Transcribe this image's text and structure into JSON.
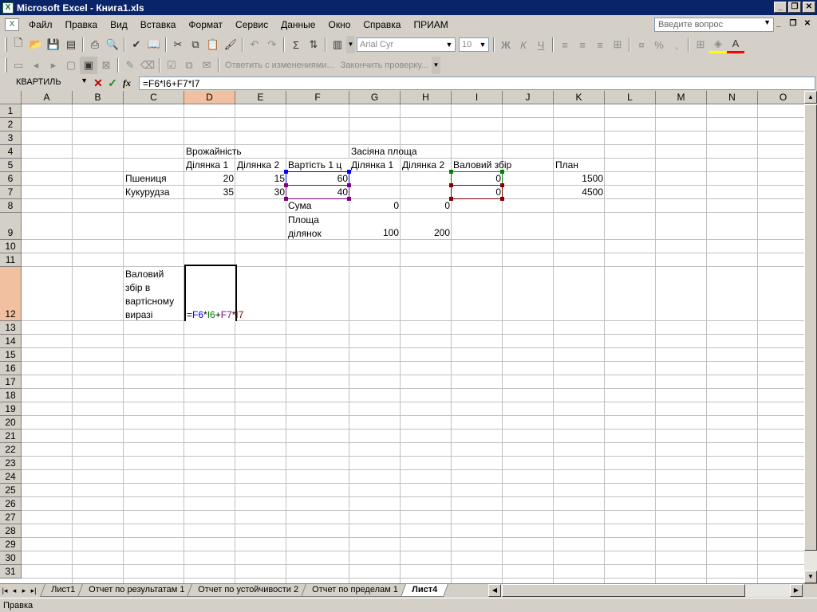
{
  "window": {
    "title": "Microsoft Excel - Книга1.xls"
  },
  "menu": [
    "Файл",
    "Правка",
    "Вид",
    "Вставка",
    "Формат",
    "Сервис",
    "Данные",
    "Окно",
    "Справка",
    "ПРИАМ"
  ],
  "ask": {
    "placeholder": "Введите вопрос"
  },
  "toolbar": {
    "font": "Arial Cyr",
    "size": "10",
    "bold": "Ж",
    "italic": "К",
    "underline": "Ч",
    "sum": "Σ",
    "percent": "%"
  },
  "reviewing": {
    "reply": "Ответить с изменениями...",
    "end": "Закончить проверку..."
  },
  "formula_bar": {
    "name_box": "КВАРТИЛЬ",
    "fx": "fx",
    "cancel": "✕",
    "enter": "✓",
    "formula": "=F6*I6+F7*I7"
  },
  "columns": [
    "A",
    "B",
    "C",
    "D",
    "E",
    "F",
    "G",
    "H",
    "I",
    "J",
    "K",
    "L",
    "M",
    "N",
    "O"
  ],
  "active_column": "D",
  "rows": [
    "1",
    "2",
    "3",
    "4",
    "5",
    "6",
    "7",
    "8",
    "9",
    "10",
    "11",
    "12",
    "13",
    "14",
    "15",
    "16",
    "17",
    "18",
    "19",
    "20",
    "21",
    "22",
    "23",
    "24",
    "25",
    "26",
    "27",
    "28",
    "29",
    "30",
    "31"
  ],
  "active_row": "12",
  "cells": {
    "D4": "Врожайність",
    "G4": "Засіяна площа",
    "D5": "Ділянка 1",
    "E5": "Ділянка 2",
    "F5": "Вартість 1 ц",
    "G5": "Ділянка 1",
    "H5": "Ділянка 2",
    "I5": "Валовий збір",
    "K5": "План",
    "C6": "Пшениця",
    "D6": "20",
    "E6": "15",
    "F6": "60",
    "I6": "0",
    "K6": "1500",
    "C7": "Кукурудза",
    "D7": "35",
    "E7": "30",
    "F7": "40",
    "I7": "0",
    "K7": "4500",
    "F8": "Сума",
    "G8": "0",
    "H8": "0",
    "F9": "Площа ділянок",
    "G9": "100",
    "H9": "200",
    "C12": "Валовий збір в вартісному виразі",
    "D12_editing": {
      "eq": "=",
      "p1": "F6",
      "op1": "*",
      "p2": "I6",
      "op2": "+",
      "p3": "F7",
      "op3": "*",
      "p4": "I7"
    }
  },
  "ref_colors": {
    "F6": "#0000ff",
    "I6": "#008000",
    "F7": "#800080",
    "I7": "#800000"
  },
  "sheet_tabs": [
    "Лист1",
    "Отчет по результатам 1",
    "Отчет по устойчивости 2",
    "Отчет по пределам 1",
    "Лист4"
  ],
  "active_tab": "Лист4",
  "status": "Правка"
}
